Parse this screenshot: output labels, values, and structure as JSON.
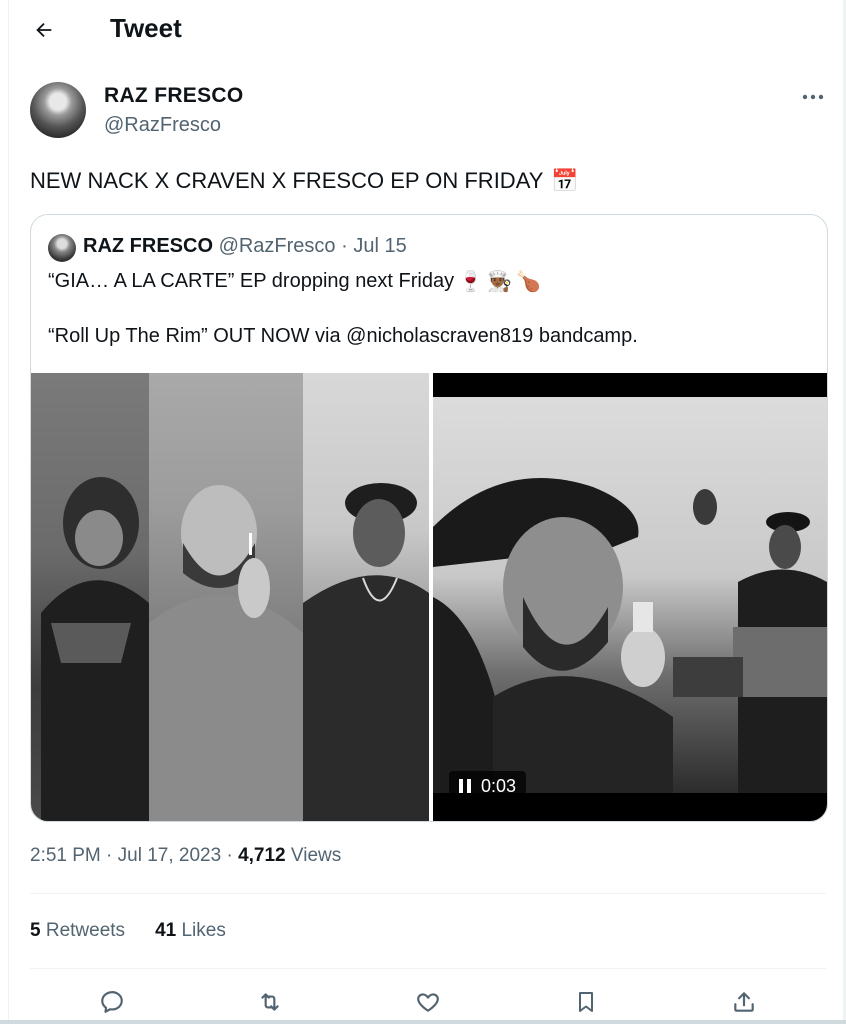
{
  "header": {
    "title": "Tweet",
    "back_icon": "arrow-left-icon"
  },
  "tweet": {
    "author_name": "RAZ FRESCO",
    "author_handle": "@RazFresco",
    "text": "NEW NACK X CRAVEN X FRESCO EP ON FRIDAY",
    "text_emoji": "📅",
    "time": "2:51 PM",
    "date": "Jul 17, 2023",
    "views_count": "4,712",
    "views_label": "Views",
    "retweets_count": "5",
    "retweets_label": "Retweets",
    "likes_count": "41",
    "likes_label": "Likes"
  },
  "quote": {
    "author_name": "RAZ FRESCO",
    "author_handle": "@RazFresco",
    "date": "Jul 15",
    "line1": "“GIA… A LA CARTE” EP dropping next Friday",
    "line1_emojis": [
      "🍷",
      "👨🏾‍🍳",
      "🍗"
    ],
    "line2": "“Roll Up The Rim” OUT NOW via @nicholascraven819 bandcamp.",
    "video_time": "0:03"
  },
  "colors": {
    "text": "#0f1419",
    "secondary": "#536471",
    "border": "#cfd9de",
    "divider": "#eff3f4"
  }
}
